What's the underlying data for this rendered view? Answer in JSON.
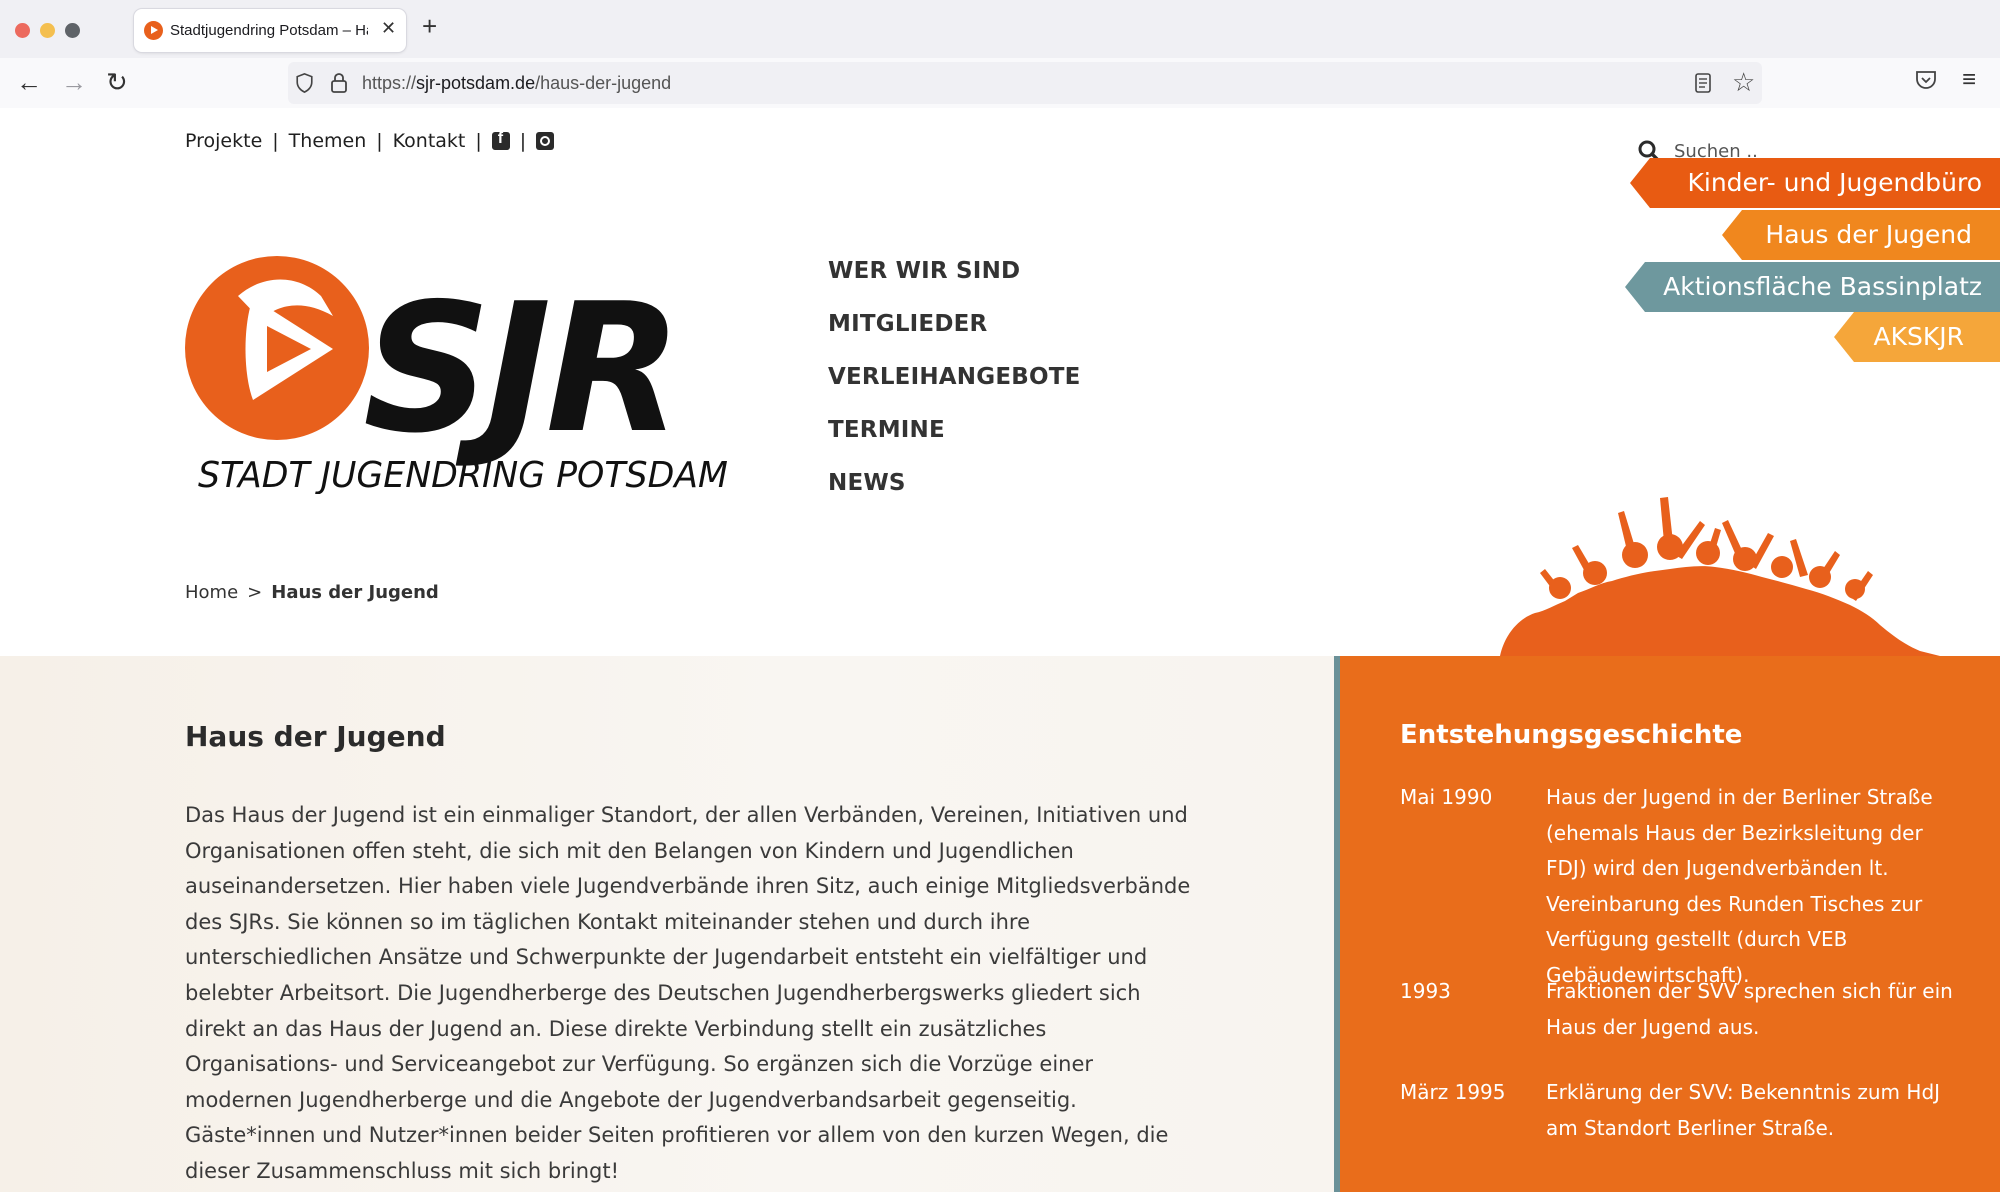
{
  "browser": {
    "tab_title": "Stadtjugendring Potsdam – Haus der Jugend",
    "url_protocol": "https://",
    "url_host": "sjr-potsdam.de",
    "url_path": "/haus-der-jugend"
  },
  "topnav": {
    "items": [
      "Projekte",
      "Themen",
      "Kontakt"
    ],
    "separator": "|",
    "social_icons": [
      "facebook-icon",
      "instagram-icon"
    ]
  },
  "search": {
    "placeholder": "Suchen .."
  },
  "logo": {
    "mark": "SJR",
    "tagline": "STADT JUGENDRING POTSDAM"
  },
  "mainnav": [
    "WER WIR SIND",
    "MITGLIEDER",
    "VERLEIHANGEBOTE",
    "TERMINE",
    "NEWS"
  ],
  "flags": [
    "Kinder- und Jugendbüro",
    "Haus der Jugend",
    "Aktionsfläche Bassinplatz",
    "AKSKJR"
  ],
  "breadcrumb": {
    "home": "Home",
    "separator": ">",
    "current": "Haus der Jugend"
  },
  "main": {
    "title": "Haus der Jugend",
    "body": "Das Haus der Jugend ist ein einmaliger Standort, der allen Verbänden, Vereinen, Initiativen und Organisationen offen steht, die sich mit den Belangen von Kindern und Jugendlichen auseinandersetzen. Hier haben viele Jugendverbände ihren Sitz, auch einige Mitgliedsverbände des SJRs. Sie können so im täglichen Kontakt miteinander stehen und durch ihre unterschiedlichen Ansätze und Schwerpunkte der Jugendarbeit entsteht ein vielfältiger und belebter Arbeitsort. Die Jugendherberge des Deutschen Jugendherbergswerks gliedert sich direkt an das Haus der Jugend an. Diese direkte Verbindung stellt ein zusätzliches Organisations- und Serviceangebot zur Verfügung. So ergänzen sich die Vorzüge einer modernen Jugendherberge und die Angebote der Jugendverbandsarbeit gegenseitig. Gäste*innen und Nutzer*innen beider Seiten profitieren vor allem von den kurzen Wegen, die dieser Zusammenschluss mit sich bringt!"
  },
  "sidebar": {
    "title": "Entstehungsgeschichte",
    "history": [
      {
        "date": "Mai 1990",
        "text": "Haus der Jugend in der Berliner Straße (ehemals Haus der Bezirksleitung der FDJ) wird den Jugendverbänden lt. Vereinbarung des Runden Tisches zur Verfügung gestellt (durch VEB Gebäudewirtschaft)."
      },
      {
        "date": "1993",
        "text": "Fraktionen der SVV sprechen sich für ein Haus der Jugend aus."
      },
      {
        "date": "März 1995",
        "text": "Erklärung der SVV: Bekenntnis zum HdJ am Standort Berliner Straße."
      }
    ]
  },
  "colors": {
    "brand_orange": "#e8601c",
    "sidebar_orange": "#e96d1b",
    "teal": "#6e989e",
    "light_orange": "#f0871e",
    "pale_orange": "#f5a63a"
  }
}
